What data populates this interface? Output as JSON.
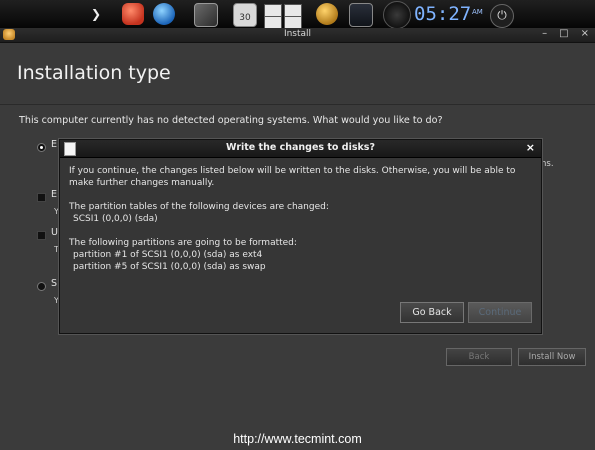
{
  "dock": {
    "clock_time": "05:27",
    "clock_ampm": "AM",
    "calendar_day": "30",
    "chevron": "❯",
    "power_glyph": "⏻"
  },
  "window": {
    "title": "Install",
    "controls": [
      "–",
      "□",
      "×"
    ]
  },
  "page": {
    "title": "Installation type",
    "question": "This computer currently has no detected operating systems. What would you like to do?",
    "options": [
      {
        "label": "E",
        "sub": "",
        "selected": true,
        "type": "radio"
      },
      {
        "label": "E",
        "sub": "Y",
        "selected": false,
        "type": "checkbox"
      },
      {
        "label": "U",
        "sub": "T",
        "selected": false,
        "type": "checkbox"
      },
      {
        "label": "S",
        "sub": "Y",
        "selected": false,
        "type": "radio"
      }
    ],
    "partial_text_right": "ns.",
    "back_button": "Back",
    "install_button": "Install Now"
  },
  "dialog": {
    "title": "Write the changes to disks?",
    "close": "×",
    "intro_line1": "If you continue, the changes listed below will be written to the disks. Otherwise, you will be able to",
    "intro_line2": "make further changes manually.",
    "partition_tables_heading": "The partition tables of the following devices are changed:",
    "partition_tables": [
      "SCSI1 (0,0,0) (sda)"
    ],
    "format_heading": "The following partitions are going to be formatted:",
    "formatted_partitions": [
      "partition #1 of SCSI1 (0,0,0) (sda) as ext4",
      "partition #5 of SCSI1 (0,0,0) (sda) as swap"
    ],
    "go_back_button": "Go Back",
    "continue_button": "Continue"
  },
  "watermark": "http://www.tecmint.com",
  "colors": {
    "clock": "#7fb3ff",
    "window_bg": "#3b3b3b",
    "dialog_bg": "#363636"
  }
}
